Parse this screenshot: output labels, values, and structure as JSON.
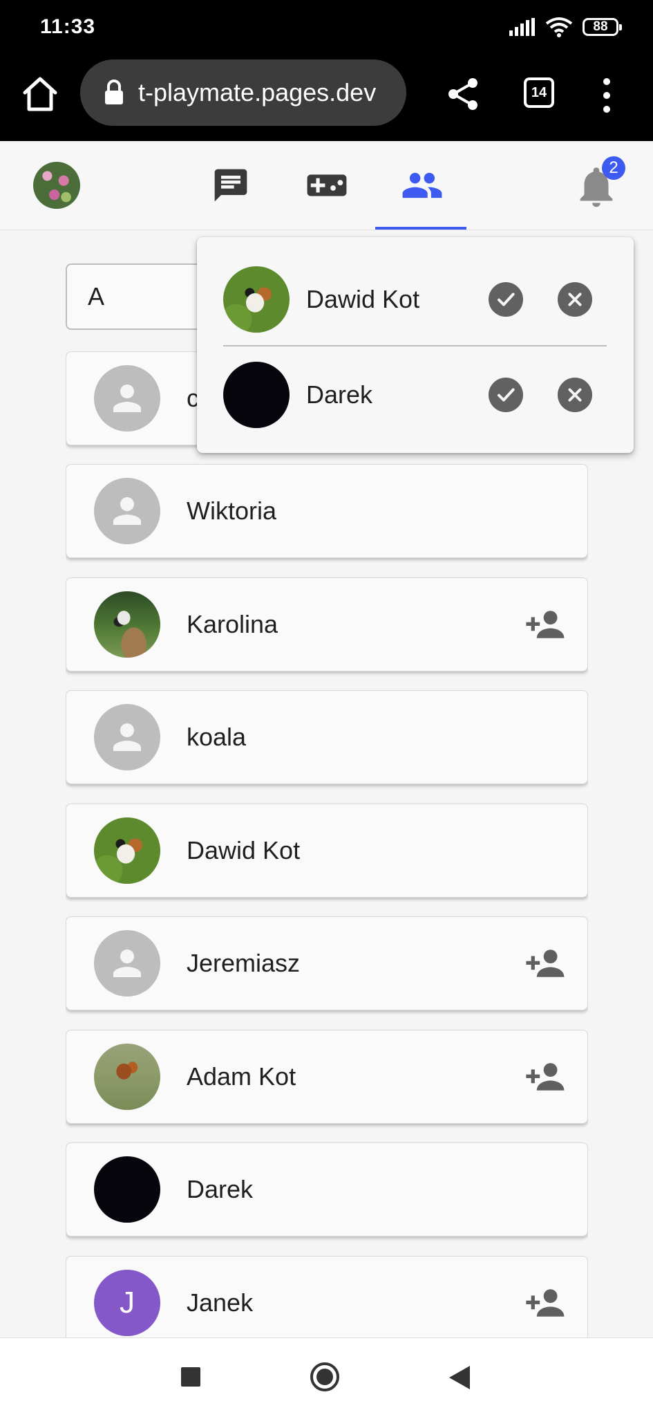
{
  "status_bar": {
    "time": "11:33",
    "battery": "88"
  },
  "browser": {
    "url": "t-playmate.pages.dev",
    "tab_count": "14"
  },
  "app_header": {
    "notification_count": "2",
    "active_tab": "friends",
    "accent_color": "#3d5af1"
  },
  "search": {
    "value": "A"
  },
  "friends_list": {
    "items": [
      {
        "name": "c",
        "avatar": "default",
        "add_button": false
      },
      {
        "name": "Wiktoria",
        "avatar": "default",
        "add_button": false
      },
      {
        "name": "Karolina",
        "avatar": "bird-photo",
        "add_button": true
      },
      {
        "name": "koala",
        "avatar": "default",
        "add_button": false
      },
      {
        "name": "Dawid Kot",
        "avatar": "cat-photo",
        "add_button": false
      },
      {
        "name": "Jeremiasz",
        "avatar": "default",
        "add_button": true
      },
      {
        "name": "Adam Kot",
        "avatar": "squirrel-photo",
        "add_button": true
      },
      {
        "name": "Darek",
        "avatar": "dark",
        "add_button": false
      },
      {
        "name": "Janek",
        "avatar": "letter",
        "avatar_letter": "J",
        "add_button": true
      }
    ]
  },
  "friend_requests": {
    "items": [
      {
        "name": "Dawid Kot",
        "avatar": "cat-photo"
      },
      {
        "name": "Darek",
        "avatar": "dark"
      }
    ]
  }
}
